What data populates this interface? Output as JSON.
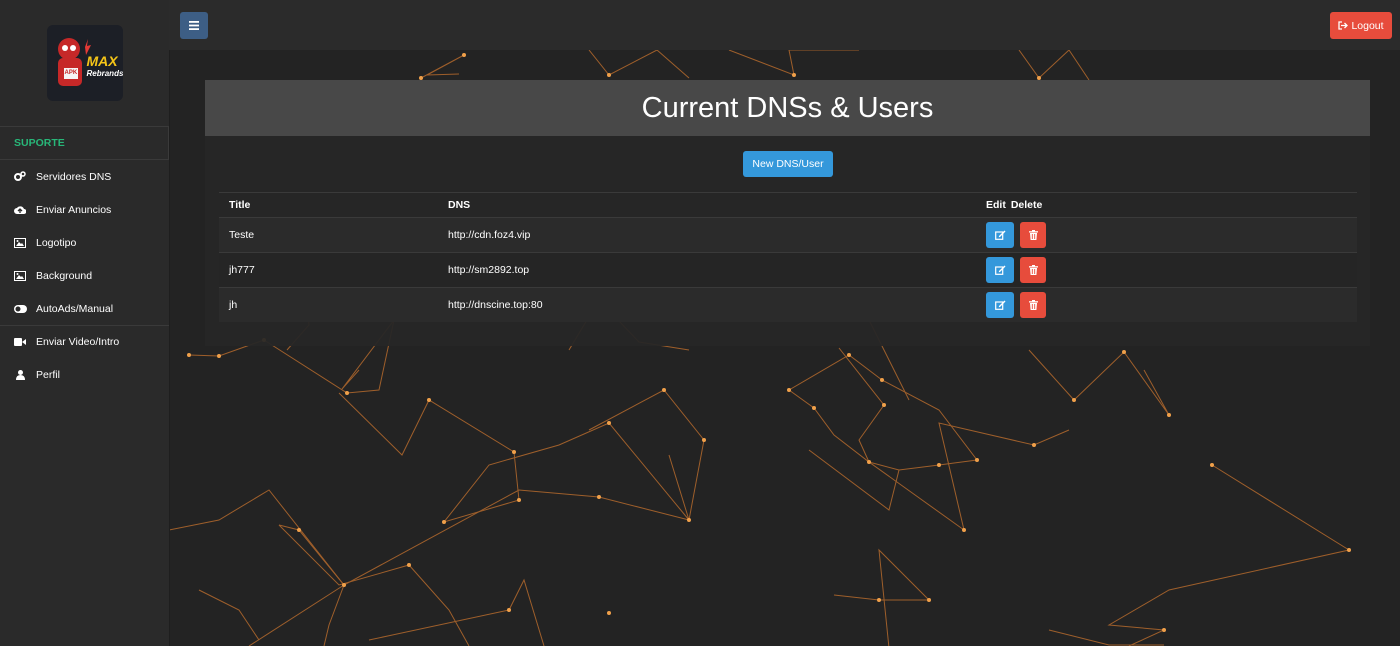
{
  "brand": {
    "logo_text_1": "MAX",
    "logo_text_2": "Rebrands",
    "logo_badge": "APK"
  },
  "topbar": {
    "menu_icon": "bars-icon",
    "logout_label": "Logout",
    "logout_icon": "sign-out-icon"
  },
  "sidebar": {
    "header": "SUPORTE",
    "items": [
      {
        "label": "Servidores DNS",
        "icon": "cogs-icon"
      },
      {
        "label": "Enviar Anuncios",
        "icon": "cloud-upload-icon"
      },
      {
        "label": "Logotipo",
        "icon": "image-icon"
      },
      {
        "label": "Background",
        "icon": "image-icon"
      },
      {
        "label": "AutoAds/Manual",
        "icon": "toggle-icon"
      },
      {
        "label": "Enviar Video/Intro",
        "icon": "video-camera-icon"
      },
      {
        "label": "Perfil",
        "icon": "user-icon"
      }
    ]
  },
  "panel": {
    "title": "Current DNSs & Users",
    "new_button": "New DNS/User",
    "columns": {
      "title": "Title",
      "dns": "DNS",
      "edit": "Edit",
      "delete": "Delete"
    },
    "rows": [
      {
        "title": "Teste",
        "dns": "http://cdn.foz4.vip"
      },
      {
        "title": "jh777",
        "dns": "http://sm2892.top"
      },
      {
        "title": "jh",
        "dns": "http://dnscine.top:80"
      }
    ]
  },
  "colors": {
    "accent_green": "#28b779",
    "primary": "#3498db",
    "danger": "#e74c3c",
    "network": "#e8893a"
  }
}
